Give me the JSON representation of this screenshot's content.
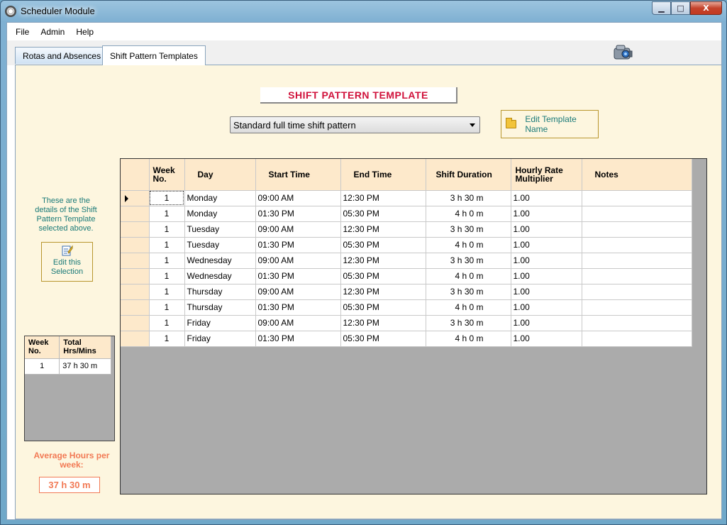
{
  "window": {
    "title": "Scheduler Module",
    "min_glyph": "▁",
    "max_glyph": "□",
    "close_glyph": "X"
  },
  "menu": {
    "items": [
      "File",
      "Admin",
      "Help"
    ]
  },
  "tabs": [
    {
      "label": "Rotas and Absences",
      "active": false
    },
    {
      "label": "Shift Pattern Templates",
      "active": true
    }
  ],
  "main": {
    "heading": "SHIFT PATTERN TEMPLATE",
    "template_select": "Standard full time shift pattern",
    "edit_template_name": "Edit Template Name",
    "side_text": "These are the details of the Shift Pattern Template selected above.",
    "edit_selection": "Edit this Selection"
  },
  "grid": {
    "columns": [
      "Week No.",
      "Day",
      "Start Time",
      "End Time",
      "Shift Duration",
      "Hourly Rate Multiplier",
      "Notes"
    ],
    "rows": [
      {
        "week": "1",
        "day": "Monday",
        "start": "09:00   AM",
        "end": "12:30   PM",
        "duration": "3 h   30 m",
        "rate": "1.00",
        "notes": ""
      },
      {
        "week": "1",
        "day": "Monday",
        "start": "01:30   PM",
        "end": "05:30   PM",
        "duration": "4 h    0 m",
        "rate": "1.00",
        "notes": ""
      },
      {
        "week": "1",
        "day": "Tuesday",
        "start": "09:00   AM",
        "end": "12:30   PM",
        "duration": "3 h   30 m",
        "rate": "1.00",
        "notes": ""
      },
      {
        "week": "1",
        "day": "Tuesday",
        "start": "01:30   PM",
        "end": "05:30   PM",
        "duration": "4 h    0 m",
        "rate": "1.00",
        "notes": ""
      },
      {
        "week": "1",
        "day": "Wednesday",
        "start": "09:00   AM",
        "end": "12:30   PM",
        "duration": "3 h   30 m",
        "rate": "1.00",
        "notes": ""
      },
      {
        "week": "1",
        "day": "Wednesday",
        "start": "01:30   PM",
        "end": "05:30   PM",
        "duration": "4 h    0 m",
        "rate": "1.00",
        "notes": ""
      },
      {
        "week": "1",
        "day": "Thursday",
        "start": "09:00   AM",
        "end": "12:30   PM",
        "duration": "3 h   30 m",
        "rate": "1.00",
        "notes": ""
      },
      {
        "week": "1",
        "day": "Thursday",
        "start": "01:30   PM",
        "end": "05:30   PM",
        "duration": "4 h    0 m",
        "rate": "1.00",
        "notes": ""
      },
      {
        "week": "1",
        "day": "Friday",
        "start": "09:00   AM",
        "end": "12:30   PM",
        "duration": "3 h   30 m",
        "rate": "1.00",
        "notes": ""
      },
      {
        "week": "1",
        "day": "Friday",
        "start": "01:30   PM",
        "end": "05:30   PM",
        "duration": "4 h    0 m",
        "rate": "1.00",
        "notes": ""
      }
    ]
  },
  "summary": {
    "columns": [
      "Week No.",
      "Total Hrs/Mins"
    ],
    "rows": [
      {
        "week": "1",
        "total": "37 h   30 m"
      }
    ]
  },
  "average": {
    "label": "Average Hours per week:",
    "value": "37 h   30 m"
  },
  "colors": {
    "accent_red": "#d0123b",
    "teal_text": "#1a7a78",
    "orange": "#f27a55",
    "header_bg": "#fde9cb",
    "panel_bg": "#fdf6df"
  }
}
